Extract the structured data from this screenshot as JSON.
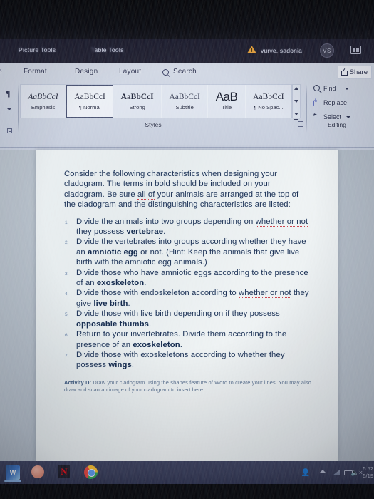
{
  "titlebar": {
    "contextual_tabs": [
      {
        "label": "Picture Tools"
      },
      {
        "label": "Table Tools"
      }
    ],
    "warning_icon": "warning-triangle-icon",
    "user_name": "vurve, sadonia",
    "avatar_initials": "VS",
    "ribbon_display_icon": "ribbon-display-options-icon"
  },
  "ribbon": {
    "tabs": [
      {
        "label": "o"
      },
      {
        "label": "Format"
      },
      {
        "label": "Design"
      },
      {
        "label": "Layout"
      },
      {
        "label": "Search"
      }
    ],
    "search_icon": "search-icon",
    "share_label": "Share",
    "share_icon": "share-icon",
    "pilcrow_icon": "paragraph-mark-icon",
    "styles": {
      "group_label": "Styles",
      "items": [
        {
          "preview": "AaBbCcI",
          "name": "Emphasis",
          "selected": false
        },
        {
          "preview": "AaBbCcI",
          "name": "¶ Normal",
          "selected": true
        },
        {
          "preview": "AaBbCcI",
          "name": "Strong",
          "selected": false
        },
        {
          "preview": "AaBbCcI",
          "name": "Subtitle",
          "selected": false
        },
        {
          "preview": "AaB",
          "name": "Title",
          "selected": false
        },
        {
          "preview": "AaBbCcI",
          "name": "¶ No Spac...",
          "selected": false
        }
      ]
    },
    "editing": {
      "group_label": "Editing",
      "find_label": "Find",
      "find_icon": "search-icon",
      "replace_label": "Replace",
      "replace_icon": "replace-icon",
      "select_label": "Select",
      "select_icon": "cursor-arrow-icon"
    }
  },
  "document": {
    "intro_before": "Consider the following characteristics when designing your cladogram. The terms in bold should be included on your cladogram. Be sure ",
    "intro_misspell": "all of",
    "intro_after": " your animals are arranged at the top of the cladogram and the distinguishing characteristics are listed:",
    "steps": [
      {
        "parts": [
          {
            "t": "Divide the animals into two groups depending on ",
            "s": "plain"
          },
          {
            "t": "whether or not",
            "s": "misspell"
          },
          {
            "t": " they possess ",
            "s": "plain"
          },
          {
            "t": "vertebrae",
            "s": "bold"
          },
          {
            "t": ".",
            "s": "plain"
          }
        ]
      },
      {
        "parts": [
          {
            "t": "Divide the vertebrates into groups according whether they have an ",
            "s": "plain"
          },
          {
            "t": "amniotic egg",
            "s": "bold"
          },
          {
            "t": " or not. (Hint:  Keep the animals that give live birth with the amniotic egg animals.)",
            "s": "plain"
          }
        ]
      },
      {
        "parts": [
          {
            "t": "Divide those who have amniotic eggs according to the presence of an ",
            "s": "plain"
          },
          {
            "t": "exoskeleton",
            "s": "bold"
          },
          {
            "t": ".",
            "s": "plain"
          }
        ]
      },
      {
        "parts": [
          {
            "t": "Divide those with endoskeleton according to ",
            "s": "plain"
          },
          {
            "t": "whether or not",
            "s": "misspell"
          },
          {
            "t": " they give ",
            "s": "plain"
          },
          {
            "t": "live birth",
            "s": "bold"
          },
          {
            "t": ".",
            "s": "plain"
          }
        ]
      },
      {
        "parts": [
          {
            "t": "Divide those with live birth depending on if they possess ",
            "s": "plain"
          },
          {
            "t": "opposable thumbs",
            "s": "bold"
          },
          {
            "t": ".",
            "s": "plain"
          }
        ]
      },
      {
        "parts": [
          {
            "t": "Return to your invertebrates. Divide them according to the presence of an ",
            "s": "plain"
          },
          {
            "t": "exoskeleton",
            "s": "bold"
          },
          {
            "t": ".",
            "s": "plain"
          }
        ]
      },
      {
        "parts": [
          {
            "t": "Divide those with exoskeletons according to whether they possess ",
            "s": "plain"
          },
          {
            "t": "wings",
            "s": "bold"
          },
          {
            "t": ".",
            "s": "plain"
          }
        ]
      }
    ],
    "activity_label": "Activity D:",
    "activity_text": " Draw your cladogram using the shapes feature of Word to create your lines.  You may also draw and scan an image of your cladogram to insert here:"
  },
  "taskbar": {
    "apps": [
      {
        "name": "word-taskbar-icon",
        "glyph": "W"
      },
      {
        "name": "photos-taskbar-icon",
        "glyph": ""
      },
      {
        "name": "netflix-taskbar-icon",
        "glyph": "N"
      },
      {
        "name": "chrome-taskbar-icon",
        "glyph": ""
      }
    ],
    "tray": {
      "person_icon": "person-icon",
      "chevron_icon": "chevron-up-icon",
      "wifi_icon": "wifi-icon",
      "battery_icon": "battery-icon",
      "volume_icon": "volume-muted-icon",
      "clock_time": "5:52",
      "clock_date": "5/19"
    }
  },
  "colors": {
    "titlebar_bg": "#201f30",
    "ribbon_bg": "#cdd4e2",
    "page_bg": "#e9eef0",
    "doc_text": "#1a2e52",
    "taskbar_bg": "#373b58",
    "accent": "#2b5797"
  }
}
